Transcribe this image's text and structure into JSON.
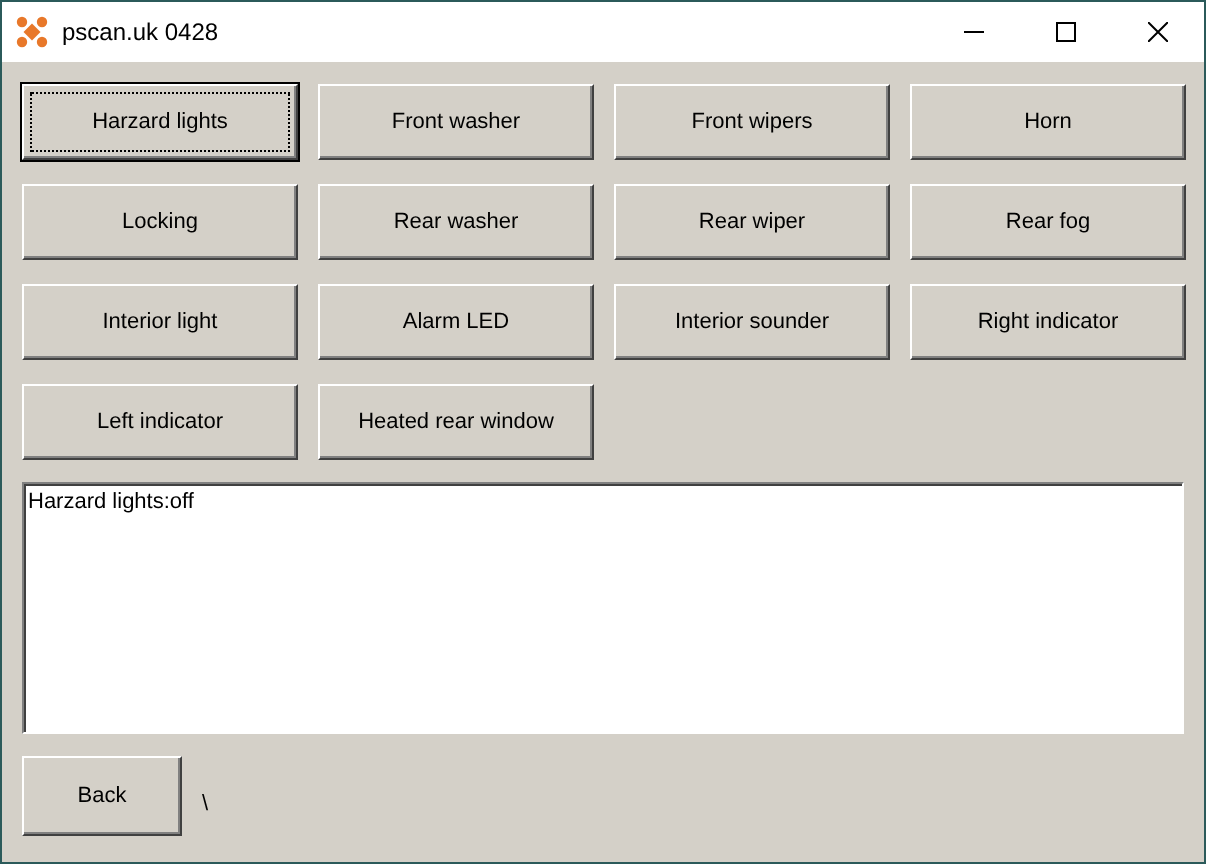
{
  "window": {
    "title": "pscan.uk 0428"
  },
  "buttons": [
    {
      "label": "Harzard lights",
      "focused": true
    },
    {
      "label": "Front washer",
      "focused": false
    },
    {
      "label": "Front wipers",
      "focused": false
    },
    {
      "label": "Horn",
      "focused": false
    },
    {
      "label": "Locking",
      "focused": false
    },
    {
      "label": "Rear washer",
      "focused": false
    },
    {
      "label": "Rear wiper",
      "focused": false
    },
    {
      "label": "Rear fog",
      "focused": false
    },
    {
      "label": "Interior light",
      "focused": false
    },
    {
      "label": "Alarm LED",
      "focused": false
    },
    {
      "label": "Interior sounder",
      "focused": false
    },
    {
      "label": "Right indicator",
      "focused": false
    },
    {
      "label": "Left indicator",
      "focused": false
    },
    {
      "label": "Heated rear window",
      "focused": false
    }
  ],
  "log": {
    "text": "Harzard lights:off"
  },
  "back_button": {
    "label": "Back"
  },
  "status": "\\"
}
